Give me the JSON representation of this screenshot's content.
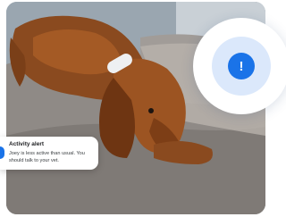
{
  "photo": {
    "subject": "dog-lying-on-sofa"
  },
  "alert_indicator": {
    "symbol": "!",
    "icon": "exclamation-icon",
    "color": "#1a73e8"
  },
  "notification": {
    "title": "Activity alert",
    "message": "Joey is less active than usual. You should talk to your vet.",
    "icon": "activity-icon",
    "accent_color": "#1a73e8"
  }
}
